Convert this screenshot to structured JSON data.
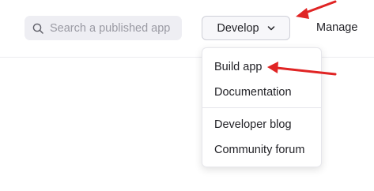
{
  "search": {
    "placeholder": "Search a published app",
    "icon": "search-icon"
  },
  "header": {
    "develop_label": "Develop",
    "manage_label": "Manage"
  },
  "develop_menu": {
    "items": [
      {
        "label": "Build app"
      },
      {
        "label": "Documentation"
      },
      {
        "label": "Developer blog"
      },
      {
        "label": "Community forum"
      }
    ]
  },
  "annotations": {
    "arrow_color": "#e02424"
  }
}
